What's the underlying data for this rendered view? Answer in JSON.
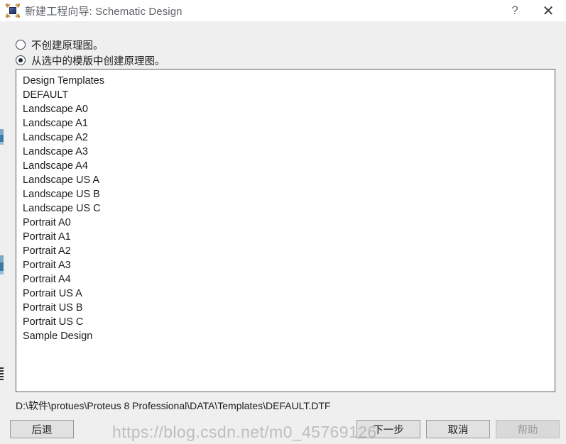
{
  "window": {
    "title": "新建工程向导: Schematic Design",
    "icon": "proteus-chip-icon",
    "help_icon": "question-mark-icon",
    "close_icon": "close-x-icon"
  },
  "options": {
    "items": [
      {
        "label": "不创建原理图。",
        "checked": false
      },
      {
        "label": "从选中的模版中创建原理图。",
        "checked": true
      }
    ]
  },
  "template_list": {
    "items": [
      "Design Templates",
      "DEFAULT",
      "Landscape A0",
      "Landscape A1",
      "Landscape A2",
      "Landscape A3",
      "Landscape A4",
      "Landscape US A",
      "Landscape US B",
      "Landscape US C",
      "Portrait A0",
      "Portrait A1",
      "Portrait A2",
      "Portrait A3",
      "Portrait A4",
      "Portrait US A",
      "Portrait US B",
      "Portrait US C",
      "Sample Design"
    ]
  },
  "path": "D:\\软件\\protues\\Proteus 8 Professional\\DATA\\Templates\\DEFAULT.DTF",
  "footer": {
    "back": "后退",
    "next": "下一步",
    "cancel": "取消",
    "help": "帮助"
  },
  "watermark": "https://blog.csdn.net/m0_45769126",
  "colors": {
    "window_bg": "#efefef",
    "titlebar_bg": "#ffffff",
    "list_bg": "#ffffff",
    "list_border": "#5a5a5a",
    "button_bg": "#e1e1e1",
    "button_border": "#9a9a9a",
    "button_disabled_bg": "#d9d9d9",
    "text": "#1c1c1c",
    "title_text": "#5f6368"
  }
}
